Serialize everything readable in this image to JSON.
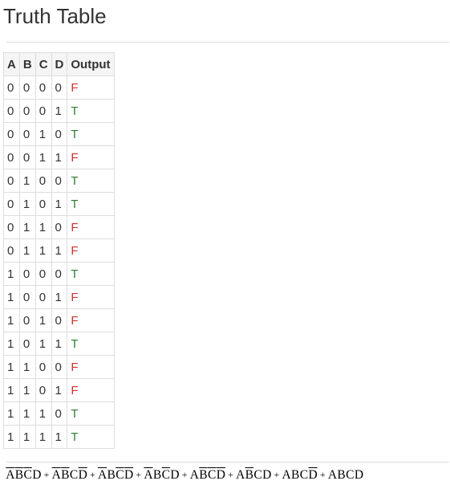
{
  "title": "Truth Table",
  "table": {
    "headers": [
      "A",
      "B",
      "C",
      "D",
      "Output"
    ],
    "rows": [
      [
        "0",
        "0",
        "0",
        "0",
        "F"
      ],
      [
        "0",
        "0",
        "0",
        "1",
        "T"
      ],
      [
        "0",
        "0",
        "1",
        "0",
        "T"
      ],
      [
        "0",
        "0",
        "1",
        "1",
        "F"
      ],
      [
        "0",
        "1",
        "0",
        "0",
        "T"
      ],
      [
        "0",
        "1",
        "0",
        "1",
        "T"
      ],
      [
        "0",
        "1",
        "1",
        "0",
        "F"
      ],
      [
        "0",
        "1",
        "1",
        "1",
        "F"
      ],
      [
        "1",
        "0",
        "0",
        "0",
        "T"
      ],
      [
        "1",
        "0",
        "0",
        "1",
        "F"
      ],
      [
        "1",
        "0",
        "1",
        "0",
        "F"
      ],
      [
        "1",
        "0",
        "1",
        "1",
        "T"
      ],
      [
        "1",
        "1",
        "0",
        "0",
        "F"
      ],
      [
        "1",
        "1",
        "0",
        "1",
        "F"
      ],
      [
        "1",
        "1",
        "1",
        "0",
        "T"
      ],
      [
        "1",
        "1",
        "1",
        "1",
        "T"
      ]
    ]
  },
  "colors": {
    "true": "#2e7d32",
    "false": "#d32f2f"
  },
  "formula": {
    "plus": "+",
    "terms": [
      [
        {
          "v": "A",
          "neg": true
        },
        {
          "v": "B",
          "neg": true
        },
        {
          "v": "C",
          "neg": true
        },
        {
          "v": "D",
          "neg": false
        }
      ],
      [
        {
          "v": "A",
          "neg": true
        },
        {
          "v": "B",
          "neg": true
        },
        {
          "v": "C",
          "neg": false
        },
        {
          "v": "D",
          "neg": true
        }
      ],
      [
        {
          "v": "A",
          "neg": true
        },
        {
          "v": "B",
          "neg": false
        },
        {
          "v": "C",
          "neg": true
        },
        {
          "v": "D",
          "neg": true
        }
      ],
      [
        {
          "v": "A",
          "neg": true
        },
        {
          "v": "B",
          "neg": false
        },
        {
          "v": "C",
          "neg": true
        },
        {
          "v": "D",
          "neg": false
        }
      ],
      [
        {
          "v": "A",
          "neg": false
        },
        {
          "v": "B",
          "neg": true
        },
        {
          "v": "C",
          "neg": true
        },
        {
          "v": "D",
          "neg": true
        }
      ],
      [
        {
          "v": "A",
          "neg": false
        },
        {
          "v": "B",
          "neg": true
        },
        {
          "v": "C",
          "neg": false
        },
        {
          "v": "D",
          "neg": false
        }
      ],
      [
        {
          "v": "A",
          "neg": false
        },
        {
          "v": "B",
          "neg": false
        },
        {
          "v": "C",
          "neg": false
        },
        {
          "v": "D",
          "neg": true
        }
      ],
      [
        {
          "v": "A",
          "neg": false
        },
        {
          "v": "B",
          "neg": false
        },
        {
          "v": "C",
          "neg": false
        },
        {
          "v": "D",
          "neg": false
        }
      ]
    ]
  }
}
